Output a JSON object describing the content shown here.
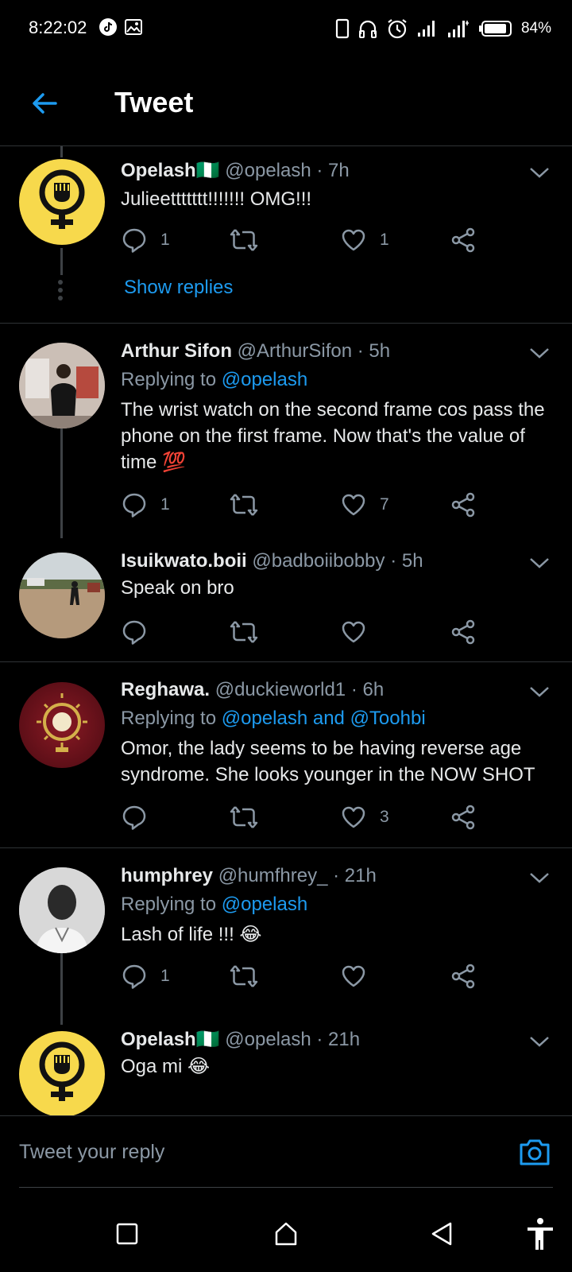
{
  "status_bar": {
    "time": "8:22:02",
    "battery_percent": "84%",
    "icons": [
      "tiktok-icon",
      "gallery-icon",
      "phone-icon",
      "headphones-icon",
      "alarm-icon",
      "signal-icon",
      "signal-icon",
      "battery-icon"
    ]
  },
  "header": {
    "title": "Tweet"
  },
  "tweets": [
    {
      "name": "Opelash🇳🇬",
      "handle": "@opelash",
      "time": "7h",
      "body": "Julieettttttt!!!!!!! OMG!!!",
      "replies": "1",
      "retweets": "",
      "likes": "1"
    },
    {
      "name": "Arthur Sifon",
      "handle": "@ArthurSifon",
      "time": "5h",
      "replying_label": "Replying to",
      "replying_to": "@opelash",
      "body": "The wrist watch on the second frame cos pass the phone on the first frame. Now that's the value of time 💯",
      "replies": "1",
      "retweets": "",
      "likes": "7"
    },
    {
      "name": "Isuikwato.boii",
      "handle": "@badboiibobby",
      "time": "5h",
      "body": "Speak on bro",
      "replies": "",
      "retweets": "",
      "likes": ""
    },
    {
      "name": "Reghawa.",
      "handle": "@duckieworld1",
      "time": "6h",
      "replying_label": "Replying to",
      "replying_to": "@opelash and @Toohbi",
      "body": "Omor, the lady seems to be having reverse age syndrome. She looks younger in the NOW SHOT",
      "replies": "",
      "retweets": "",
      "likes": "3"
    },
    {
      "name": "humphrey",
      "handle": "@humfhrey_",
      "time": "21h",
      "replying_label": "Replying to",
      "replying_to": "@opelash",
      "body": "Lash of life !!! 😂",
      "replies": "1",
      "retweets": "",
      "likes": ""
    },
    {
      "name": "Opelash🇳🇬",
      "handle": "@opelash",
      "time": "21h",
      "body": "Oga mi 😂"
    }
  ],
  "show_replies_label": "Show replies",
  "reply_bar": {
    "placeholder": "Tweet your reply"
  },
  "colors": {
    "accent": "#1d9bf0",
    "background": "#000000",
    "secondary_text": "#8b98a5",
    "divider": "#2f3336",
    "avatar_yellow": "#f7d94c"
  }
}
